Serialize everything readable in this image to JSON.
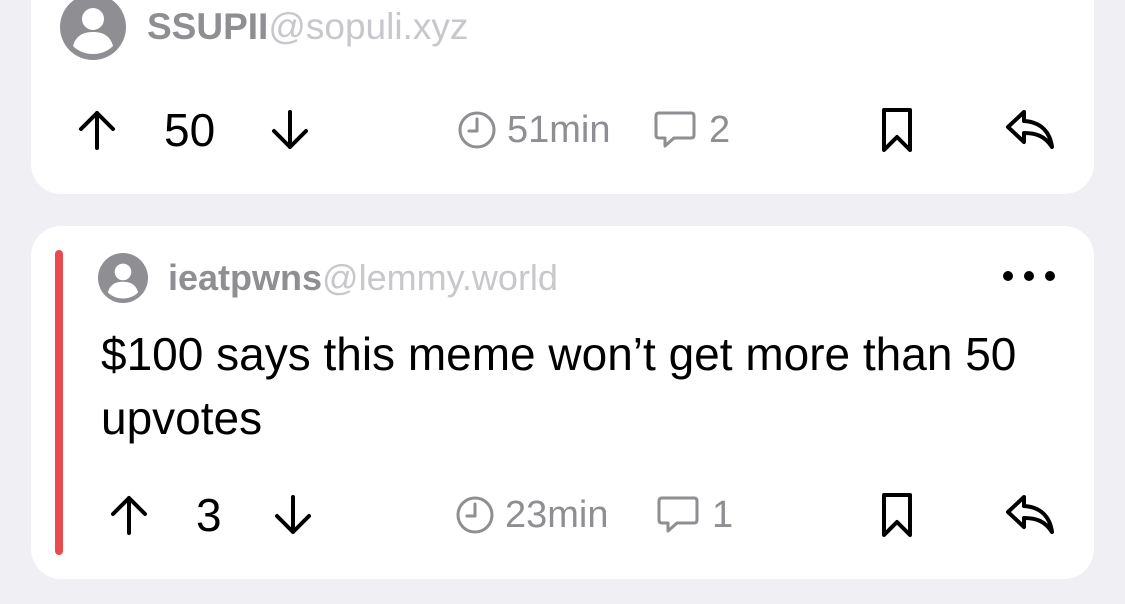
{
  "comments": [
    {
      "username": "SSUPII",
      "instance": "@sopuli.xyz",
      "score": "50",
      "age": "51min",
      "replies": "2"
    },
    {
      "username": "ieatpwns",
      "instance": "@lemmy.world",
      "body": "$100 says this meme won’t get more than 50 upvotes",
      "score": "3",
      "age": "23min",
      "replies": "1",
      "indent_color": "#e84c4f"
    }
  ],
  "icons": [
    "person-avatar-icon",
    "upvote-arrow-icon",
    "downvote-arrow-icon",
    "clock-icon",
    "comment-bubble-icon",
    "bookmark-icon",
    "reply-icon",
    "more-dots-icon"
  ]
}
